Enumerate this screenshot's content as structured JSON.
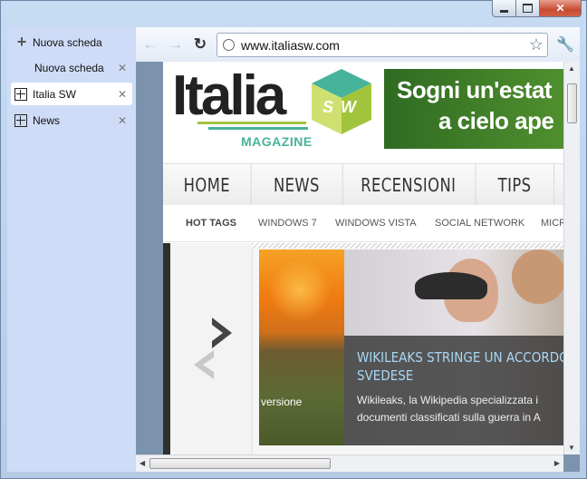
{
  "browser": {
    "tabs": [
      {
        "label": "Nuova scheda",
        "kind": "new",
        "icon": "plus-icon"
      },
      {
        "label": "Nuova scheda",
        "kind": "blank"
      },
      {
        "label": "Italia SW",
        "kind": "active",
        "icon": "italiasw-favicon"
      },
      {
        "label": "News",
        "kind": "normal",
        "icon": "italiasw-favicon"
      }
    ],
    "close_glyph": "✕",
    "url": "www.italiasw.com"
  },
  "site": {
    "logo_text": "Italia",
    "logo_sub": "MAGAZINE",
    "logo_badge": "SW",
    "banner_line1": "Sogni un'estat",
    "banner_line2": "a cielo ape",
    "nav": [
      "HOME",
      "NEWS",
      "RECENSIONI",
      "TIPS"
    ],
    "tags": [
      "HOT TAGS",
      "WINDOWS 7",
      "WINDOWS VISTA",
      "SOCIAL NETWORK",
      "MICR"
    ],
    "slide": {
      "title_line1": "WIKILEAKS STRINGE UN ACCORDO DI",
      "title_line2": "SVEDESE",
      "text_line1": "Wikileaks, la Wikipedia specializzata i",
      "text_line2": "documenti classificati sulla guerra in A",
      "side_label": "versione"
    }
  },
  "colors": {
    "logo_green": "#a2c43c",
    "logo_teal": "#47b39a",
    "banner_green": "#3d7d28",
    "caption_title": "#a8d8f5"
  }
}
